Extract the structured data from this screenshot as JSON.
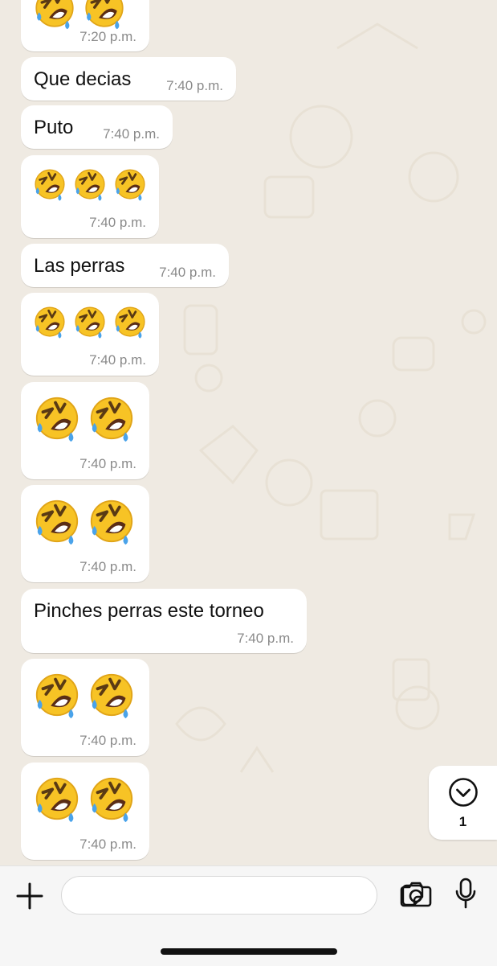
{
  "messages": [
    {
      "text": "",
      "time": "7:20 p.m."
    },
    {
      "text": "Que decias",
      "time": "7:40 p.m."
    },
    {
      "text": "Puto",
      "time": "7:40 p.m."
    },
    {
      "text": "🤣🤣🤣",
      "time": "7:40 p.m."
    },
    {
      "text": "Las perras",
      "time": "7:40 p.m."
    },
    {
      "text": "🤣🤣🤣",
      "time": "7:40 p.m."
    },
    {
      "text": "🤣🤣",
      "time": "7:40 p.m."
    },
    {
      "text": "🤣🤣",
      "time": "7:40 p.m."
    },
    {
      "text": "Pinches perras este torneo",
      "time": "7:40 p.m."
    },
    {
      "text": "🤣🤣",
      "time": "7:40 p.m."
    },
    {
      "text": "🤣🤣",
      "time": "7:40 p.m."
    }
  ],
  "scroll_down": {
    "icon": "chevron-down-circle-icon",
    "unread_count": "1"
  },
  "composer": {
    "icons": [
      "plus-icon",
      "sticker-icon",
      "camera-icon",
      "microphone-icon"
    ],
    "input_value": ""
  },
  "emoji_name": "rolling-on-the-floor-laughing-emoji",
  "colors": {
    "chat_bg": "#efeae2",
    "bubble": "#ffffff",
    "time": "#8a8a8a",
    "composer_bg": "#f6f6f6"
  }
}
